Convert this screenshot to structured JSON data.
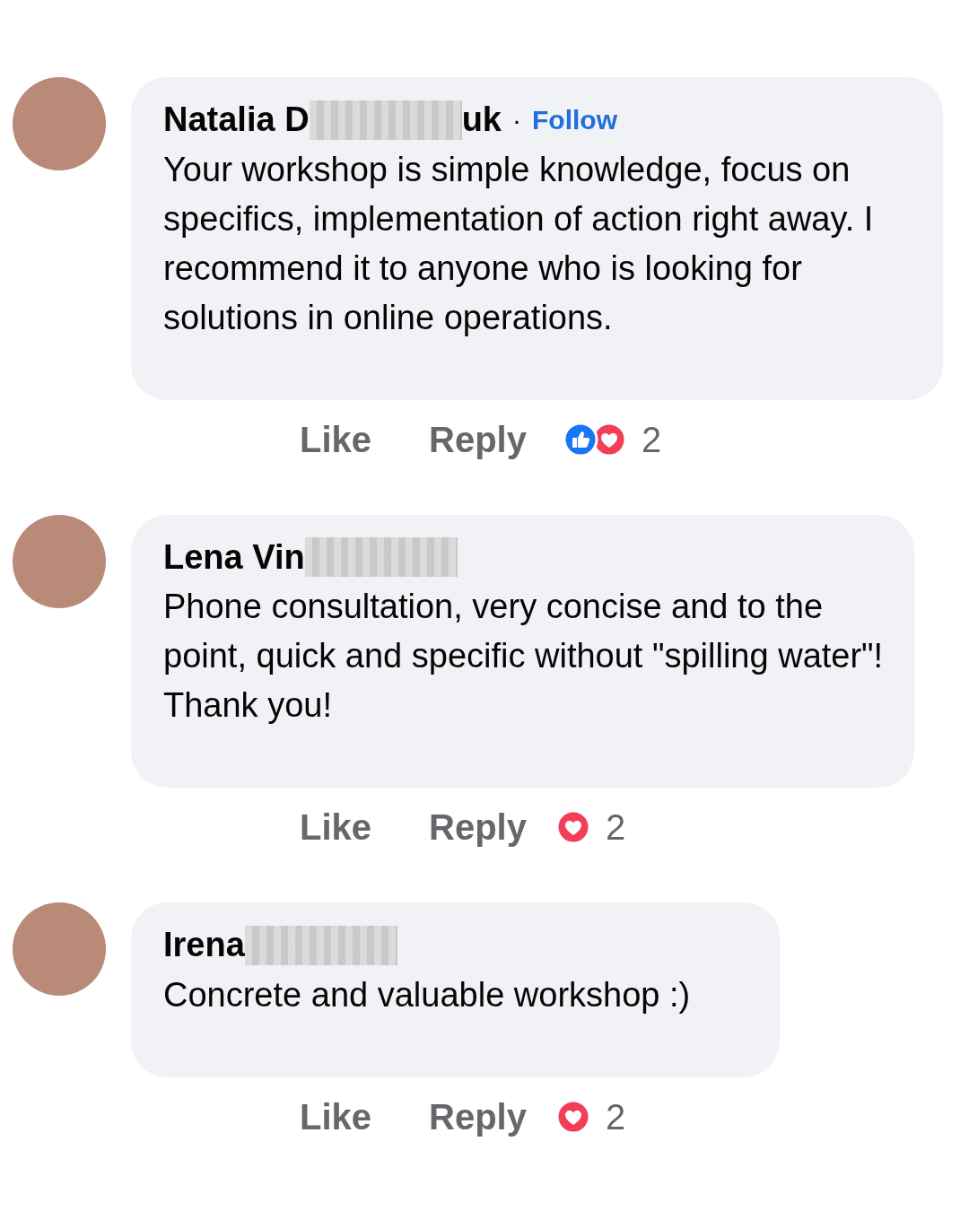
{
  "comments": [
    {
      "name": "Natalia D",
      "name_redacted": true,
      "name_tail": "uk",
      "follow": "Follow",
      "separator": "·",
      "text": "Your workshop is simple knowledge, focus on specifics, implementation of action right away. I recommend it to anyone who is looking for solutions in online operations.",
      "actions": [
        "Like",
        "Reply"
      ],
      "reactions": [
        {
          "kind": "like"
        },
        {
          "kind": "love"
        }
      ],
      "reaction_count": "2"
    },
    {
      "name": "Lena Vin",
      "name_redacted": true,
      "text": "Phone consultation, very concise and to the point, quick and specific without \"spilling water\"! Thank you!",
      "actions": [
        "Like",
        "Reply"
      ],
      "reactions": [
        {
          "kind": "love"
        }
      ],
      "reaction_count": "2"
    },
    {
      "name": "Irena",
      "name_redacted": true,
      "text": "Concrete and valuable workshop :)",
      "actions": [
        "Like",
        "Reply"
      ],
      "reactions": [
        {
          "kind": "love"
        }
      ],
      "reaction_count": "2"
    }
  ]
}
